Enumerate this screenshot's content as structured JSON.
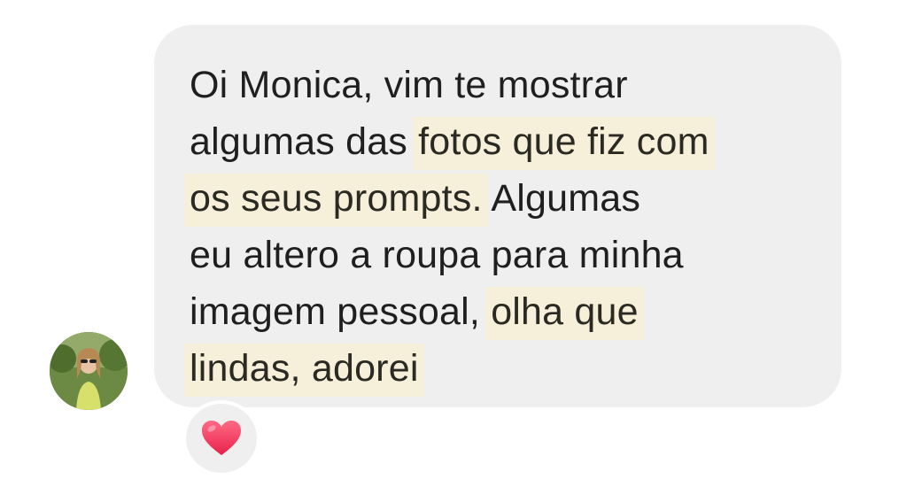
{
  "message": {
    "segments": [
      {
        "text": "Oi Monica, vim te mostrar",
        "highlighted": false,
        "line": 1
      },
      {
        "text": "algumas das ",
        "highlighted": false,
        "line": 2
      },
      {
        "text": "fotos que fiz com",
        "highlighted": true,
        "line": 2
      },
      {
        "text": "os seus prompts.",
        "highlighted": true,
        "line": 3
      },
      {
        "text": " Algumas",
        "highlighted": false,
        "line": 3
      },
      {
        "text": "eu altero a roupa para minha",
        "highlighted": false,
        "line": 4
      },
      {
        "text": "imagem pessoal, ",
        "highlighted": false,
        "line": 5
      },
      {
        "text": "olha que",
        "highlighted": true,
        "line": 5
      },
      {
        "text": "lindas, adorei",
        "highlighted": true,
        "line": 6
      }
    ]
  },
  "reaction": {
    "emoji": "heart-icon"
  },
  "colors": {
    "bubble": "#efefef",
    "highlight": "#f6efd9",
    "heart": "#f0365a",
    "text": "#1f1f1f"
  }
}
